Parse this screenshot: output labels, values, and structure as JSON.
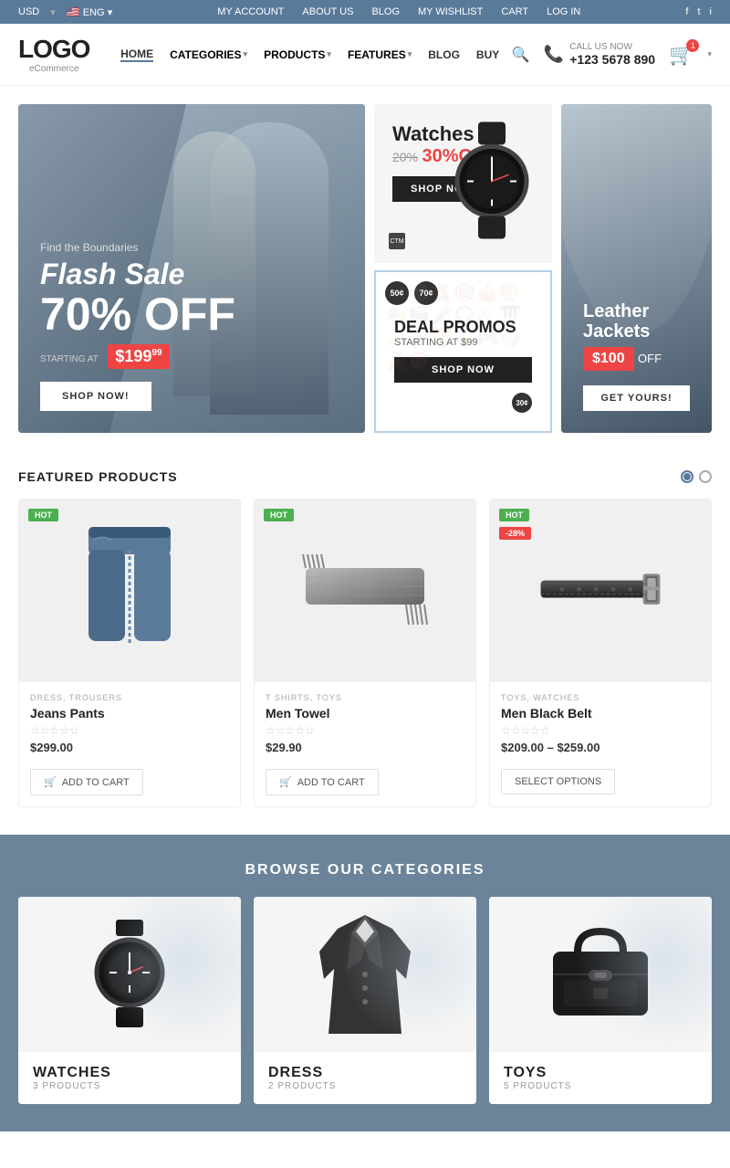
{
  "topbar": {
    "currency": "USD",
    "language": "ENG",
    "links": [
      "MY ACCOUNT",
      "ABOUT US",
      "BLOG",
      "MY WISHLIST",
      "CART",
      "LOG IN"
    ],
    "social": [
      "f",
      "t",
      "i"
    ]
  },
  "header": {
    "logo": "LOGO",
    "logo_sub": "eCommerce",
    "call_label": "CALL US NOW",
    "phone": "+123 5678 890",
    "cart_count": "1",
    "nav": [
      {
        "label": "HOME",
        "active": true
      },
      {
        "label": "CATEGORIES",
        "dropdown": true
      },
      {
        "label": "PRODUCTS",
        "dropdown": true
      },
      {
        "label": "FEATURES",
        "dropdown": true
      },
      {
        "label": "BLOG"
      },
      {
        "label": "BUY"
      }
    ]
  },
  "hero": {
    "main": {
      "find": "Find the Boundaries",
      "flash": "Flash Sale",
      "off": "70% OFF",
      "starting": "STARTING AT",
      "price": "$199",
      "price_sup": "99",
      "btn": "SHOP NOW!"
    },
    "watches": {
      "title": "Watches",
      "old_price": "20%",
      "new_price": "30%OFF",
      "btn": "SHOP NOW"
    },
    "deal": {
      "badge1": "50¢",
      "badge2": "70¢",
      "badge3": "30¢",
      "title": "DEAL PROMOS",
      "starting": "STARTING AT $99",
      "btn": "SHOP NOW"
    },
    "leather": {
      "title": "Leather Jackets",
      "price": "$100",
      "off": "OFF",
      "btn": "GET YOURS!"
    }
  },
  "featured": {
    "title": "FEATURED PRODUCTS",
    "products": [
      {
        "tag": "HOT",
        "categories": "DRESS, TROUSERS",
        "name": "Jeans Pants",
        "stars": "★★★★★",
        "price": "$299.00",
        "btn": "ADD TO CART"
      },
      {
        "tag": "HOT",
        "categories": "T SHIRTS, TOYS",
        "name": "Men Towel",
        "stars": "★★★★★",
        "price": "$29.90",
        "btn": "ADD TO CART"
      },
      {
        "tag": "HOT",
        "tag_sale": "-28%",
        "categories": "TOYS, WATCHES",
        "name": "Men Black Belt",
        "stars": "★★★★★",
        "price": "$209.00 – $259.00",
        "btn": "SELECT OPTIONS"
      }
    ]
  },
  "browse": {
    "title": "BROWSE OUR CATEGORIES",
    "categories": [
      {
        "name": "WATCHES",
        "count": "3 PRODUCTS"
      },
      {
        "name": "DRESS",
        "count": "2 PRODUCTS"
      },
      {
        "name": "TOYS",
        "count": "5 PRODUCTS"
      }
    ]
  }
}
